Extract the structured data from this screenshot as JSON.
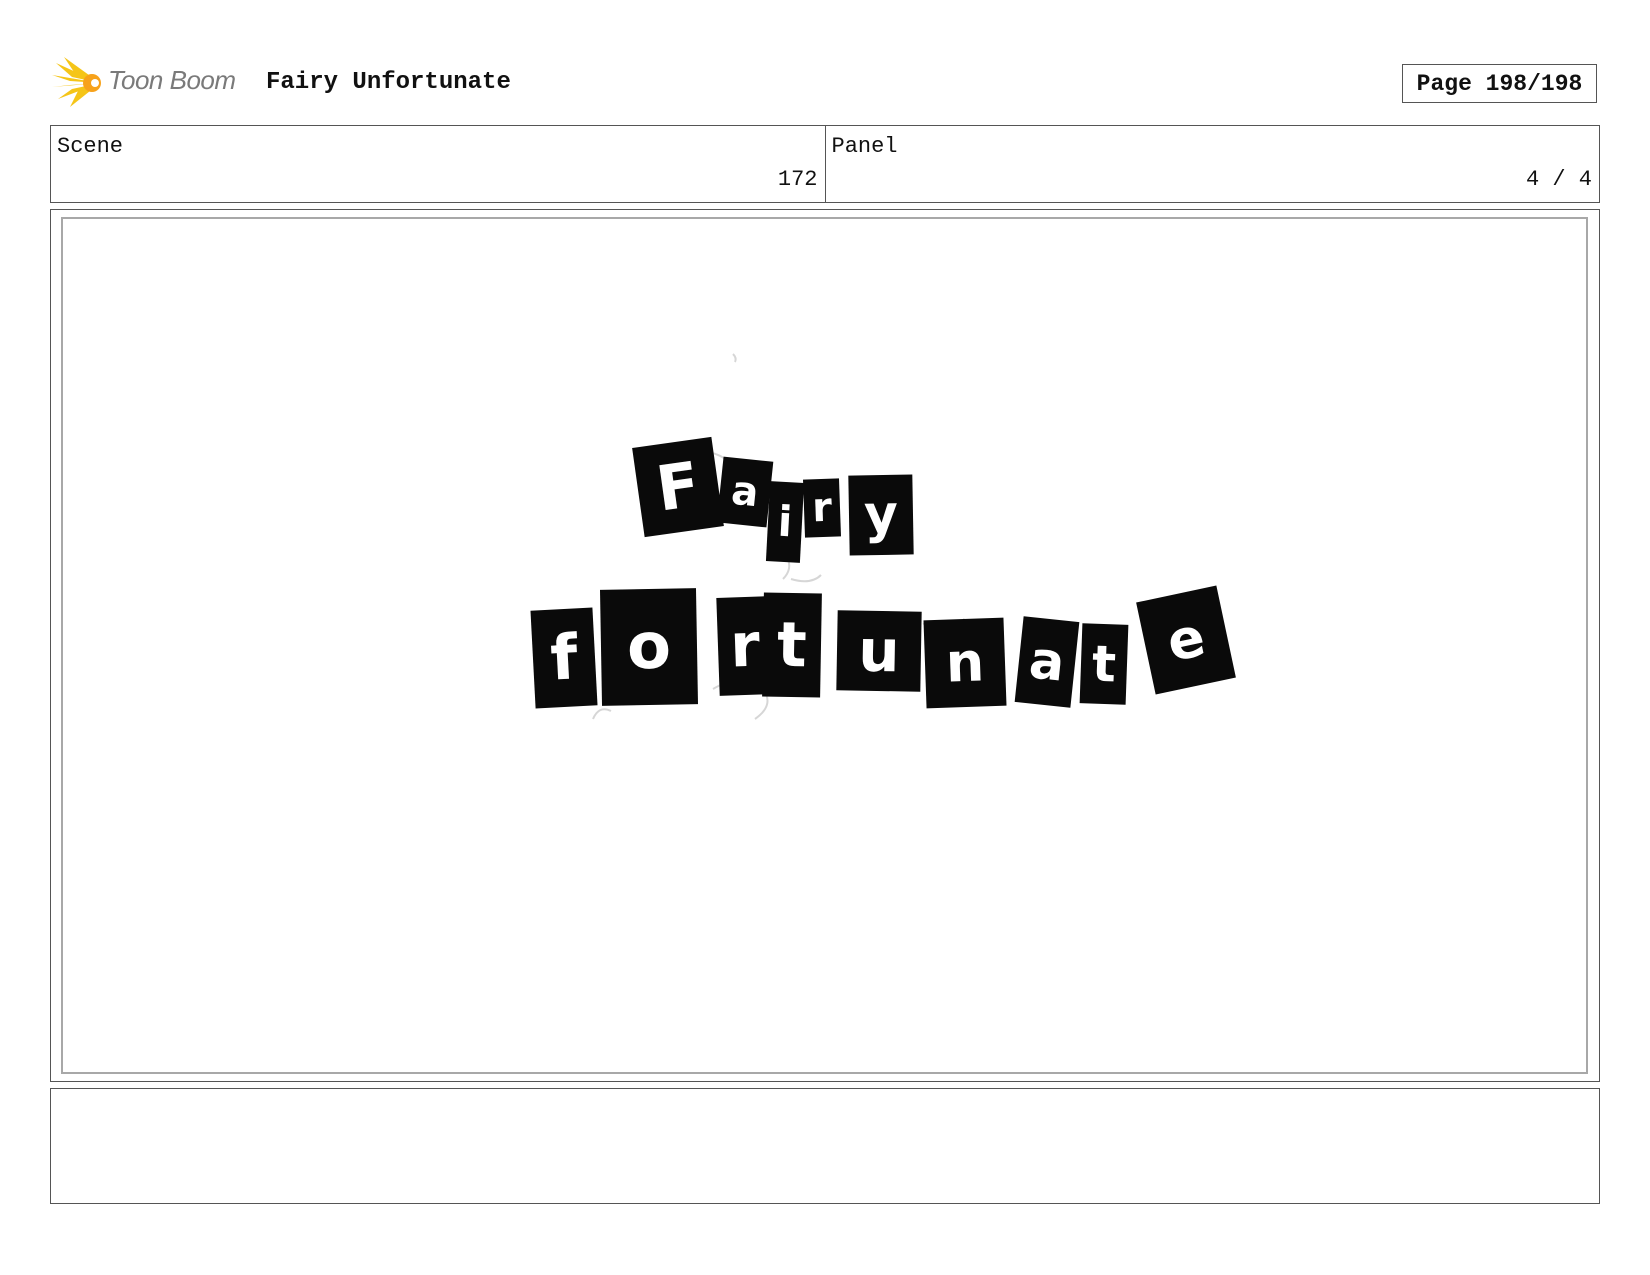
{
  "header": {
    "logo_text": "Toon Boom",
    "logo_icon": "toon-boom-burst-icon",
    "title": "Fairy Unfortunate",
    "page_label": "Page 198/198"
  },
  "info": {
    "scene_label": "Scene",
    "scene_value": "172",
    "panel_label": "Panel",
    "panel_value": "4 / 4"
  },
  "panel_art": {
    "line1_letters": [
      "F",
      "a",
      "i",
      "r",
      "y"
    ],
    "line2_letters": [
      "f",
      "o",
      "r",
      "t",
      "u",
      "n",
      "a",
      "t",
      "e"
    ]
  },
  "notes": {
    "text": ""
  },
  "colors": {
    "logo_yellow": "#f5c518",
    "logo_gray": "#7a7a7a",
    "tile_black": "#0a0a0a",
    "border": "#555555",
    "inner_border": "#a8a8a8"
  }
}
